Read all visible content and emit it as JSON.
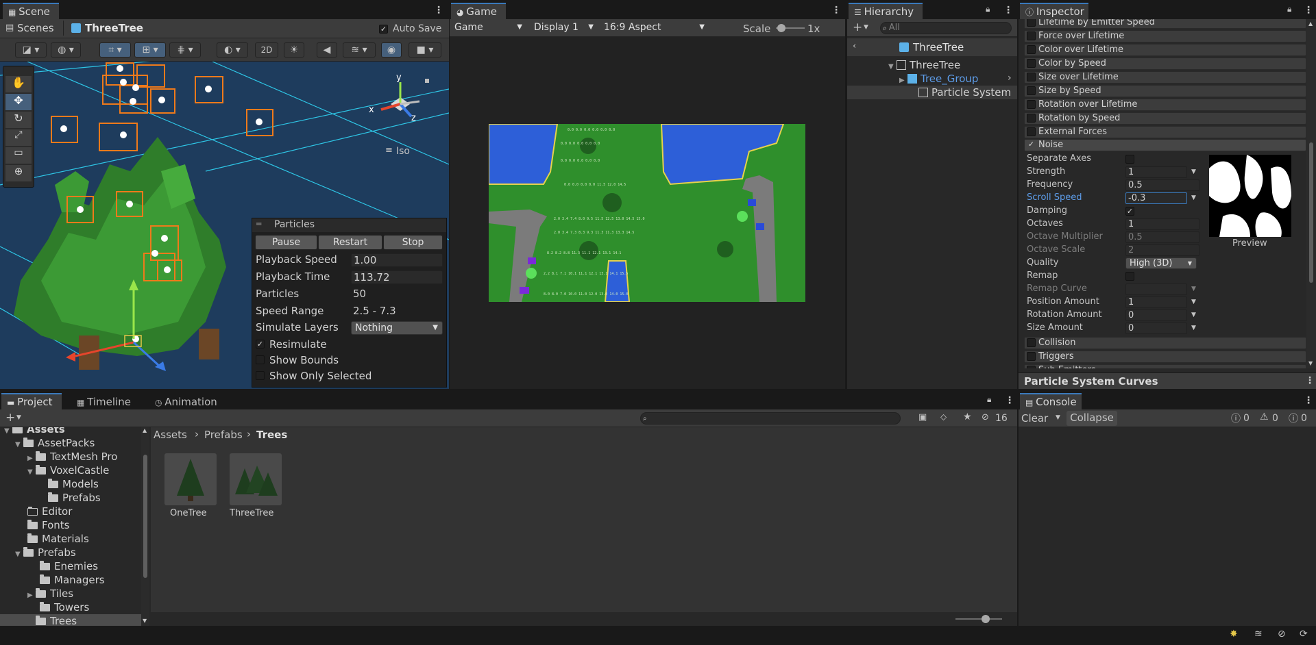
{
  "scene": {
    "tab": "Scene",
    "breadcrumb_root": "Scenes",
    "breadcrumb_prefab": "ThreeTree",
    "auto_save": "Auto Save",
    "btn_2d": "2D",
    "iso_label": "Iso",
    "gizmo": {
      "x": "x",
      "y": "y",
      "z": "z"
    }
  },
  "particles_overlay": {
    "title": "Particles",
    "pause": "Pause",
    "restart": "Restart",
    "stop": "Stop",
    "playback_speed_label": "Playback Speed",
    "playback_speed": "1.00",
    "playback_time_label": "Playback Time",
    "playback_time": "113.72",
    "particles_label": "Particles",
    "particles": "50",
    "speed_range_label": "Speed Range",
    "speed_range": "2.5 - 7.3",
    "simulate_layers_label": "Simulate Layers",
    "simulate_layers": "Nothing",
    "resimulate": "Resimulate",
    "show_bounds": "Show Bounds",
    "show_only_selected": "Show Only Selected"
  },
  "game": {
    "tab": "Game",
    "mode": "Game",
    "display": "Display 1",
    "aspect": "16:9 Aspect",
    "scale_label": "Scale",
    "scale_value": "1x"
  },
  "hierarchy": {
    "tab": "Hierarchy",
    "search_placeholder": "All",
    "prefab_header": "ThreeTree",
    "items": [
      "ThreeTree",
      "Tree_Group",
      "Particle System"
    ]
  },
  "inspector": {
    "tab": "Inspector",
    "modules_top": [
      "Lifetime by Emitter Speed",
      "Force over Lifetime",
      "Color over Lifetime",
      "Color by Speed",
      "Size over Lifetime",
      "Size by Speed",
      "Rotation over Lifetime",
      "Rotation by Speed",
      "External Forces"
    ],
    "noise_label": "Noise",
    "noise_props": {
      "separate_axes": "Separate Axes",
      "strength_label": "Strength",
      "strength": "1",
      "frequency_label": "Frequency",
      "frequency": "0.5",
      "scroll_speed_label": "Scroll Speed",
      "scroll_speed": "-0.3",
      "damping_label": "Damping",
      "octaves_label": "Octaves",
      "octaves": "1",
      "octave_multiplier_label": "Octave Multiplier",
      "octave_multiplier": "0.5",
      "octave_scale_label": "Octave Scale",
      "octave_scale": "2",
      "quality_label": "Quality",
      "quality": "High (3D)",
      "remap_label": "Remap",
      "remap_curve_label": "Remap Curve",
      "position_amount_label": "Position Amount",
      "position_amount": "1",
      "rotation_amount_label": "Rotation Amount",
      "rotation_amount": "0",
      "size_amount_label": "Size Amount",
      "size_amount": "0"
    },
    "preview_label": "Preview",
    "modules_bottom": [
      "Collision",
      "Triggers",
      "Sub Emitters"
    ],
    "curves_header": "Particle System Curves"
  },
  "project": {
    "tabs": [
      "Project",
      "Timeline",
      "Animation"
    ],
    "hidden_count": "16",
    "breadcrumb": [
      "Assets",
      "Prefabs",
      "Trees"
    ],
    "tree": [
      "Assets",
      "AssetPacks",
      "TextMesh Pro",
      "VoxelCastle",
      "Models",
      "Prefabs",
      "Editor",
      "Fonts",
      "Materials",
      "Prefabs",
      "Enemies",
      "Managers",
      "Tiles",
      "Towers",
      "Trees"
    ],
    "assets": [
      "OneTree",
      "ThreeTree"
    ]
  },
  "console": {
    "tab": "Console",
    "clear": "Clear",
    "collapse": "Collapse",
    "info_count": "0",
    "warn_count": "0",
    "error_count": "0"
  }
}
